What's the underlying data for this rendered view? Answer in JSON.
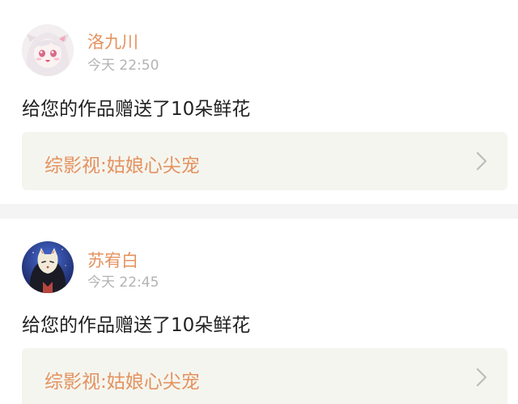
{
  "notifications": [
    {
      "username": "洛九川",
      "timestamp": "今天 22:50",
      "message": "给您的作品赠送了10朵鲜花",
      "work_title": "综影视:姑娘心尖宠",
      "avatar_icon": "anime-girl-avatar"
    },
    {
      "username": "苏宥白",
      "timestamp": "今天 22:45",
      "message": "给您的作品赠送了10朵鲜花",
      "work_title": "综影视:姑娘心尖宠",
      "avatar_icon": "fox-mask-avatar"
    }
  ],
  "colors": {
    "accent": "#e4925f",
    "muted": "#b3b3b3",
    "link_bg": "#f5f5ef",
    "separator": "#f4f4f4"
  }
}
